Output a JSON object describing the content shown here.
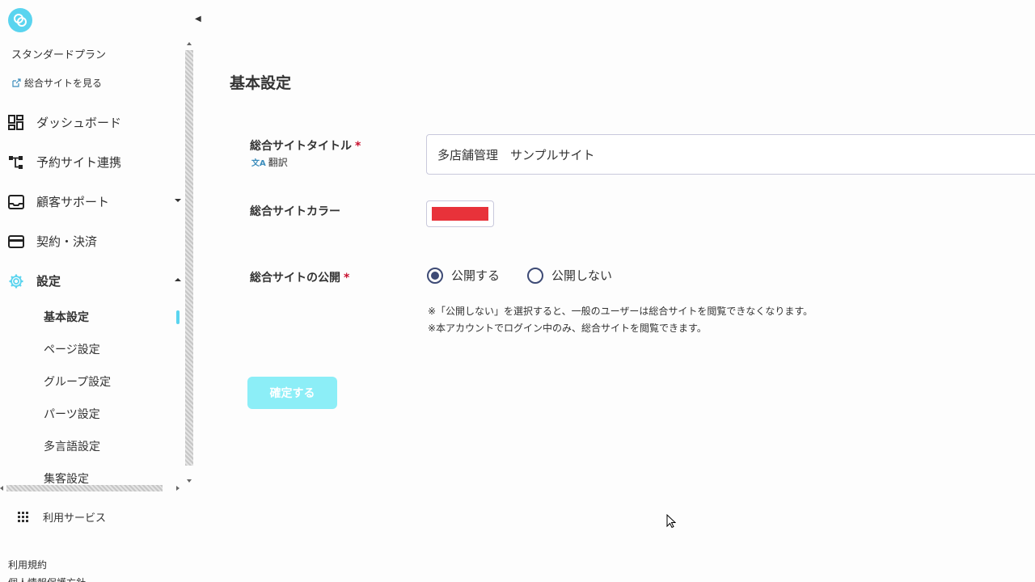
{
  "sidebar": {
    "plan": "スタンダードプラン",
    "site_link": "総合サイトを見る",
    "nav": [
      {
        "label": "ダッシュボード",
        "icon": "dashboard-icon"
      },
      {
        "label": "予約サイト連携",
        "icon": "hierarchy-icon"
      },
      {
        "label": "顧客サポート",
        "icon": "inbox-icon"
      },
      {
        "label": "契約・決済",
        "icon": "credit-card-icon"
      },
      {
        "label": "設定",
        "icon": "gear-icon"
      }
    ],
    "settings_sub": [
      {
        "label": "基本設定"
      },
      {
        "label": "ページ設定"
      },
      {
        "label": "グループ設定"
      },
      {
        "label": "パーツ設定"
      },
      {
        "label": "多言語設定"
      },
      {
        "label": "集客設定"
      }
    ],
    "services": "利用サービス",
    "footer": [
      "利用規約",
      "個人情報保護方針"
    ]
  },
  "main": {
    "title": "基本設定",
    "site_title_label": "総合サイトタイトル",
    "required_mark": "*",
    "translate_label": "翻訳",
    "site_title_value": "多店舗管理　サンプルサイト",
    "color_label": "総合サイトカラー",
    "site_color": "#e8323a",
    "publish_label": "総合サイトの公開",
    "publish_options": [
      "公開する",
      "公開しない"
    ],
    "publish_selected": "公開する",
    "notes": [
      "※「公開しない」を選択すると、一般のユーザーは総合サイトを閲覧できなくなります。",
      "※本アカウントでログイン中のみ、総合サイトを閲覧できます。"
    ],
    "confirm_button": "確定する"
  },
  "colors": {
    "accent": "#5ad4ef",
    "button_disabled": "#8ceef7",
    "required": "#c8102e",
    "radio": "#3d4a75"
  }
}
